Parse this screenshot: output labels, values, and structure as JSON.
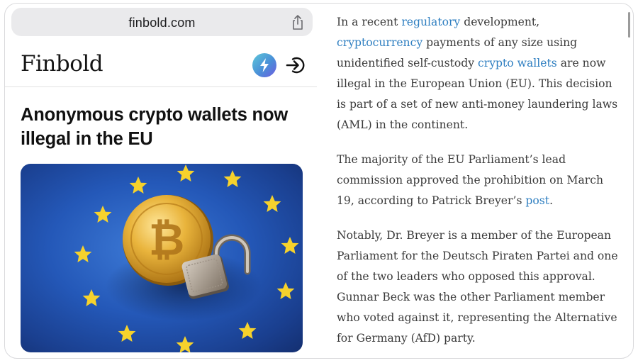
{
  "browser": {
    "url": "finbold.com"
  },
  "site": {
    "logo": "Finbold"
  },
  "article": {
    "headline_line1": "Anonymous crypto wallets now",
    "headline_line2": "illegal in the EU",
    "image_alt": "bitcoin coin and padlock on EU flag"
  },
  "body": {
    "p1": {
      "t1": "In a recent ",
      "l1": "regulatory",
      "t2": " development, ",
      "l2": "cryptocurrency",
      "t3": " payments of any size using unidentified self-custody ",
      "l3": "crypto wallets",
      "t4": " are now illegal in the European Union (EU). This decision is part of a set of new anti-money laundering laws (AML) in the continent."
    },
    "p2": {
      "t1": "The majority of the EU Parliament’s lead commission approved the prohibition on March 19, according to Patrick Breyer’s ",
      "l1": "post",
      "t2": "."
    },
    "p3": {
      "t1": "Notably, Dr. Breyer is a member of the European Parliament for the Deutsch Piraten Partei and one of the two leaders who opposed this approval. Gunnar Beck was the other Parliament member who voted against it, representing the Alternative for Germany (AfD) party."
    }
  },
  "colors": {
    "link": "#2f7fc1",
    "eu_blue": "#2458b8",
    "star_yellow": "#f6d22c"
  },
  "icons": {
    "share": "share-icon",
    "bolt": "lightning-bolt-icon",
    "login": "login-arrow-icon"
  }
}
